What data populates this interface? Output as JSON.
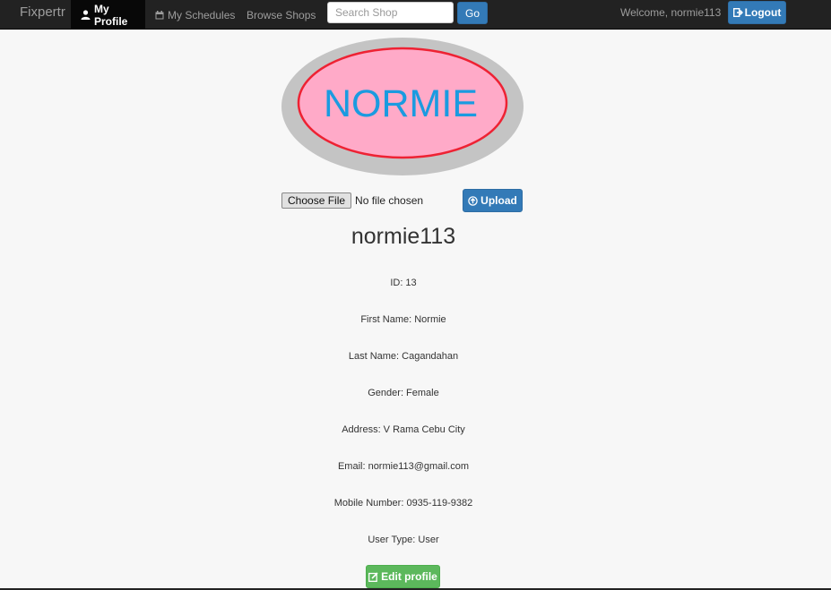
{
  "navbar": {
    "brand": "Fixpertr",
    "items": [
      {
        "label": "My Profile",
        "icon": "user-icon"
      },
      {
        "label": "My Schedules",
        "icon": "calendar-icon"
      },
      {
        "label": "Browse Shops"
      }
    ],
    "search": {
      "placeholder": "Search Shop",
      "value": "",
      "go_label": "Go"
    },
    "welcome": "Welcome, normie113",
    "logout_label": "Logout"
  },
  "avatar": {
    "text": "NORMIE"
  },
  "upload": {
    "choose_label": "Choose File",
    "status": "No file chosen",
    "upload_label": "Upload"
  },
  "profile": {
    "username": "normie113",
    "fields": [
      "ID: 13",
      "First Name: Normie",
      "Last Name: Cagandahan",
      "Gender: Female",
      "Address: V Rama Cebu City",
      "Email: normie113@gmail.com",
      "Mobile Number: 0935-119-9382",
      "User Type: User"
    ],
    "edit_label": "Edit profile"
  },
  "colors": {
    "navbar": "#222222",
    "primary": "#337ab7",
    "success": "#5cb85c",
    "avatar_fill": "#ffaac8",
    "avatar_border": "#ee2233",
    "avatar_text": "#1a9be0",
    "avatar_halo": "#c4c4c4"
  }
}
